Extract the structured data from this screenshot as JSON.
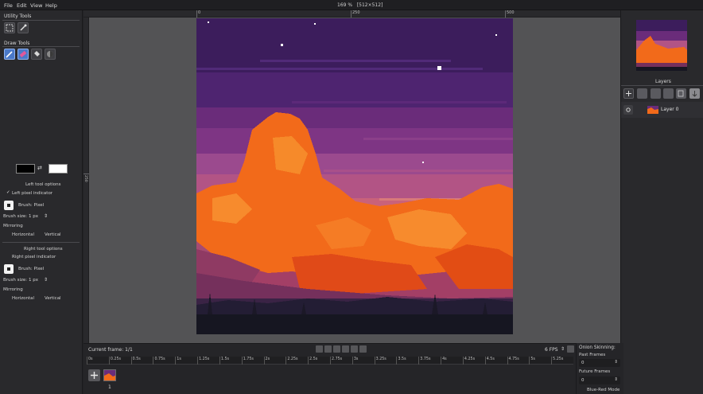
{
  "menubar": {
    "items": [
      "File",
      "Edit",
      "View",
      "Help"
    ],
    "zoom": "169 %",
    "canvas_size": "[512×512]"
  },
  "left_panel": {
    "utility_tools_title": "Utility Tools",
    "utility_tools": [
      "rectangle-select-icon",
      "color-picker-icon"
    ],
    "draw_tools_title": "Draw Tools",
    "draw_tools": [
      "pencil-icon",
      "eraser-icon",
      "bucket-fill-icon",
      "lighten-darken-icon"
    ],
    "left_color": "#000000",
    "right_color": "#ffffff",
    "left_options": {
      "title": "Left tool options",
      "pixel_indicator": "Left pixel indicator",
      "brush": "Brush: Pixel",
      "brush_size_label": "Brush size:",
      "brush_size_value": "1 px",
      "mirroring": "Mirroring",
      "horizontal": "Horizontal",
      "vertical": "Vertical"
    },
    "right_options": {
      "title": "Right tool options",
      "pixel_indicator": "Right pixel indicator",
      "brush": "Brush: Pixel",
      "brush_size_label": "Brush size:",
      "brush_size_value": "1 px",
      "mirroring": "Mirroring",
      "horizontal": "Horizontal",
      "vertical": "Vertical"
    }
  },
  "ruler": {
    "top_labels": [
      "0",
      "250",
      "500"
    ],
    "left_labels": [
      "250"
    ]
  },
  "right_panel": {
    "layers_title": "Layers",
    "layer_buttons": [
      "add-layer-icon",
      "remove-layer-icon",
      "move-up-icon",
      "move-down-icon",
      "clone-layer-icon",
      "merge-down-icon"
    ],
    "layers": [
      {
        "name": "Layer 0"
      }
    ]
  },
  "timeline": {
    "current_frame": "Current frame: 1/1",
    "fps": "6 FPS",
    "ruler_labels": [
      "0s",
      "0.25s",
      "0.5s",
      "0.75s",
      "1s",
      "1.25s",
      "1.5s",
      "1.75s",
      "2s",
      "2.25s",
      "2.5s",
      "2.75s",
      "3s",
      "3.25s",
      "3.5s",
      "3.75s",
      "4s",
      "4.25s",
      "4.5s",
      "4.75s",
      "5s",
      "5.25s"
    ],
    "frame_number": "1"
  },
  "onion": {
    "title": "Onion Skinning:",
    "past_label": "Past Frames",
    "past_value": "0",
    "future_label": "Future Frames",
    "future_value": "0",
    "mode": "Blue-Red Mode"
  },
  "colors": {
    "accent": "#4a79c9",
    "sky_top": "#3d1f5f",
    "cloud_orange": "#f46a1c"
  }
}
